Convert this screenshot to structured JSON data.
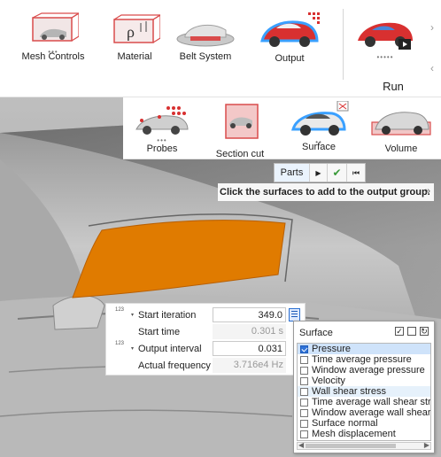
{
  "ribbon_top": {
    "tools": [
      {
        "label": "Mesh Controls",
        "dots": "•••"
      },
      {
        "label": "Material"
      },
      {
        "label": "Belt System"
      },
      {
        "label": "Output"
      }
    ],
    "run": {
      "label": "Run",
      "dots": "•••••"
    }
  },
  "ribbon_secondary": {
    "tools": [
      {
        "label": "Probes",
        "dots": "•••"
      },
      {
        "label": "Section cut"
      },
      {
        "label": "Surface",
        "dots": "••"
      },
      {
        "label": "Volume"
      }
    ]
  },
  "material_glyph": "ρ",
  "parts_toolbar": {
    "parts_label": "Parts",
    "play_glyph": "▶",
    "check_glyph": "✔",
    "skip_glyph": "⏮"
  },
  "hint": {
    "text": "Click the surfaces to add to the output group.",
    "expand_glyph": "»"
  },
  "settings": {
    "prefix": "123",
    "start_iteration": {
      "label": "Start iteration",
      "value": "349.0"
    },
    "start_time": {
      "label": "Start time",
      "value": "0.301 s"
    },
    "output_interval": {
      "label": "Output interval",
      "value": "0.031"
    },
    "actual_frequency": {
      "label": "Actual frequency",
      "value": "3.716e4 Hz"
    }
  },
  "surface_popup": {
    "title": "Surface",
    "options": [
      {
        "label": "Pressure",
        "checked": true
      },
      {
        "label": "Time average pressure",
        "checked": false
      },
      {
        "label": "Window average pressure",
        "checked": false
      },
      {
        "label": "Velocity",
        "checked": false
      },
      {
        "label": "Wall shear stress",
        "checked": false
      },
      {
        "label": "Time average wall shear stress",
        "checked": false
      },
      {
        "label": "Window average wall shear stress",
        "checked": false
      },
      {
        "label": "Surface normal",
        "checked": false
      },
      {
        "label": "Mesh displacement",
        "checked": false
      }
    ]
  },
  "colors": {
    "selection_orange": "#e07b00",
    "highlight_blue": "#2f73d8",
    "car_red": "#d83030",
    "car_grey": "#bdbdbd"
  }
}
